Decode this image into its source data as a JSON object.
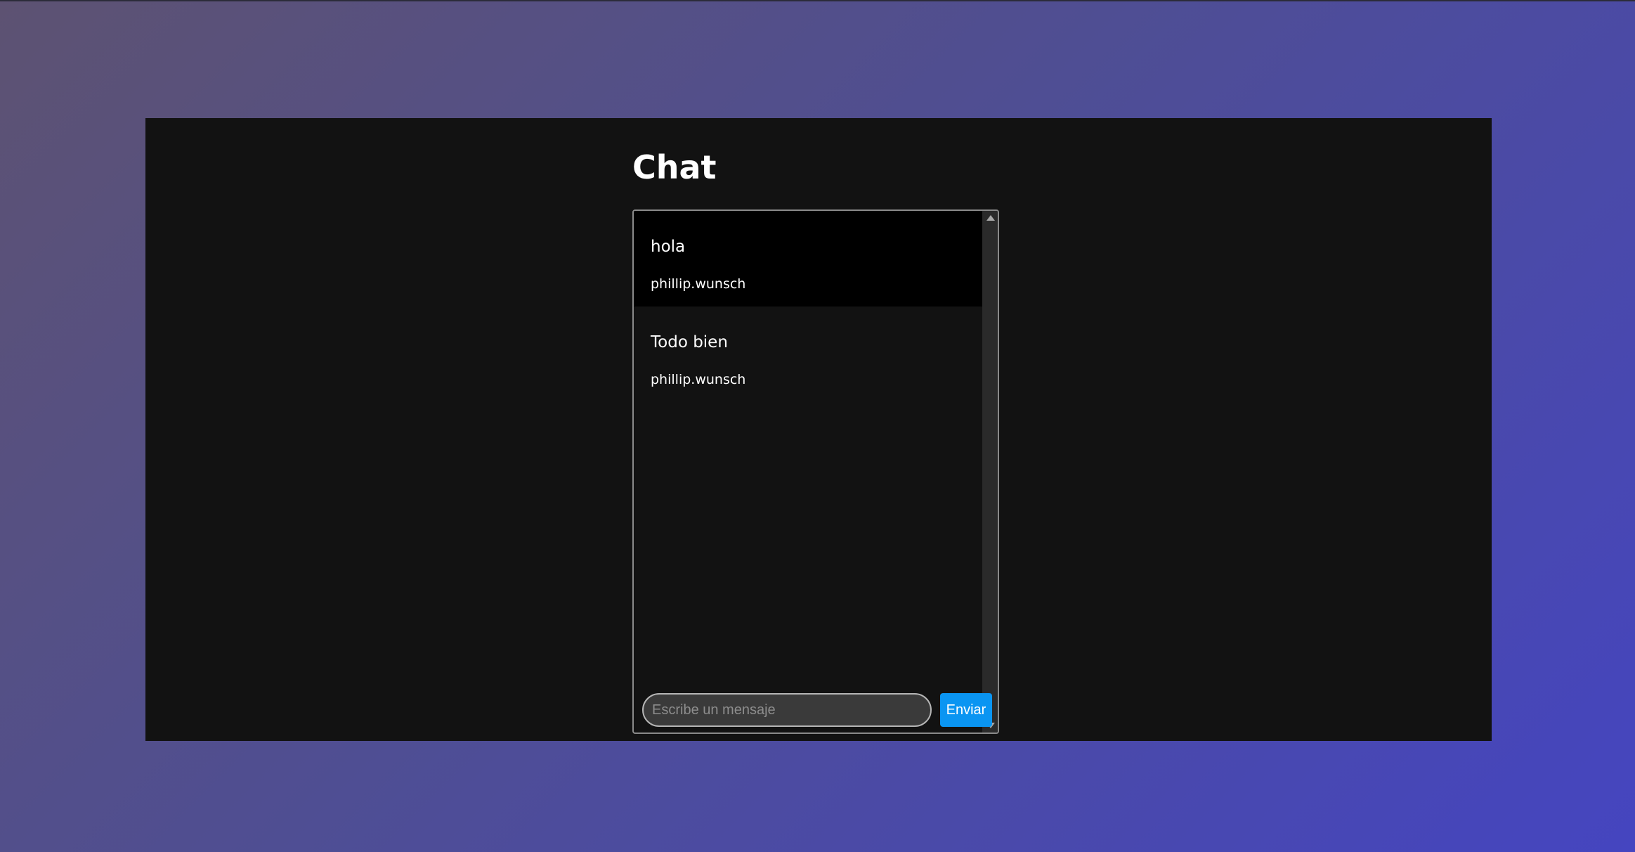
{
  "page": {
    "title": "Chat"
  },
  "messages": [
    {
      "text": "hola",
      "author": "phillip.wunsch",
      "highlighted": true
    },
    {
      "text": "Todo bien",
      "author": "phillip.wunsch",
      "highlighted": false
    }
  ],
  "composer": {
    "placeholder": "Escribe un mensaje",
    "value": "",
    "send_label": "Enviar"
  },
  "colors": {
    "background_gradient": [
      "#5d5272",
      "#4545c0"
    ],
    "panel": "#121212",
    "highlight_row": "#000000",
    "send_button": "#0a95f2"
  },
  "icons": {
    "scroll_up": "triangle-up-icon",
    "scroll_down": "triangle-down-icon"
  }
}
